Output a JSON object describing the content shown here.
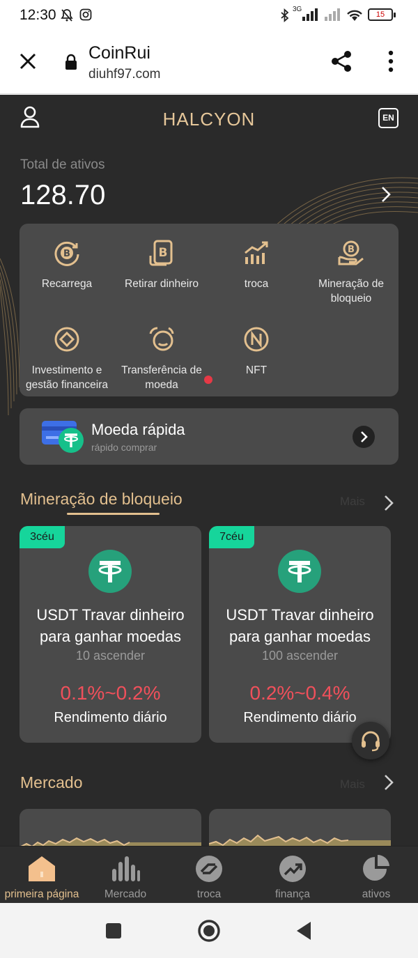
{
  "status_bar": {
    "time": "12:30",
    "network": "3G",
    "battery": "15"
  },
  "browser": {
    "title": "CoinRui",
    "url": "diuhf97.com"
  },
  "app": {
    "brand": "HALCYON",
    "lang_badge": "EN",
    "assets_label": "Total de ativos",
    "assets_value": "128.70",
    "menu": [
      {
        "label": "Recarrega",
        "icon": "recharge-icon"
      },
      {
        "label": "Retirar dinheiro",
        "icon": "withdraw-icon"
      },
      {
        "label": "troca",
        "icon": "trade-chart-icon"
      },
      {
        "label": "Mineração de bloqueio",
        "icon": "mining-icon"
      },
      {
        "label": "Investimento e gestão financeira",
        "icon": "investment-icon"
      },
      {
        "label": "Transferência de moeda",
        "icon": "transfer-icon"
      },
      {
        "label": "NFT",
        "icon": "nft-icon"
      }
    ],
    "quick": {
      "title": "Moeda rápida",
      "subtitle": "rápido comprar"
    },
    "mining_section": {
      "title": "Mineração de bloqueio",
      "more": "Mais"
    },
    "products": [
      {
        "badge": "3céu",
        "title": "USDT Travar dinheiro para ganhar moedas",
        "subtitle": "10 ascender",
        "rate": "0.1%~0.2%",
        "rate_label": "Rendimento diário"
      },
      {
        "badge": "7céu",
        "title": "USDT Travar dinheiro para ganhar moedas",
        "subtitle": "100 ascender",
        "rate": "0.2%~0.4%",
        "rate_label": "Rendimento diário"
      }
    ],
    "market_section": {
      "title": "Mercado",
      "more": "Mais"
    }
  },
  "bottom_nav": [
    {
      "label": "primeira página",
      "icon": "home-icon",
      "active": true
    },
    {
      "label": "Mercado",
      "icon": "bar-chart-icon",
      "active": false
    },
    {
      "label": "troca",
      "icon": "swap-icon",
      "active": false
    },
    {
      "label": "finança",
      "icon": "trend-up-icon",
      "active": false
    },
    {
      "label": "ativos",
      "icon": "pie-chart-icon",
      "active": false
    }
  ],
  "colors": {
    "accent_gold": "#e3c08f",
    "background": "#2a2a2a",
    "card": "#4a4a4a",
    "rate_red": "#f0505b",
    "badge_green": "#16d59b",
    "tether_green": "#26a17b"
  }
}
